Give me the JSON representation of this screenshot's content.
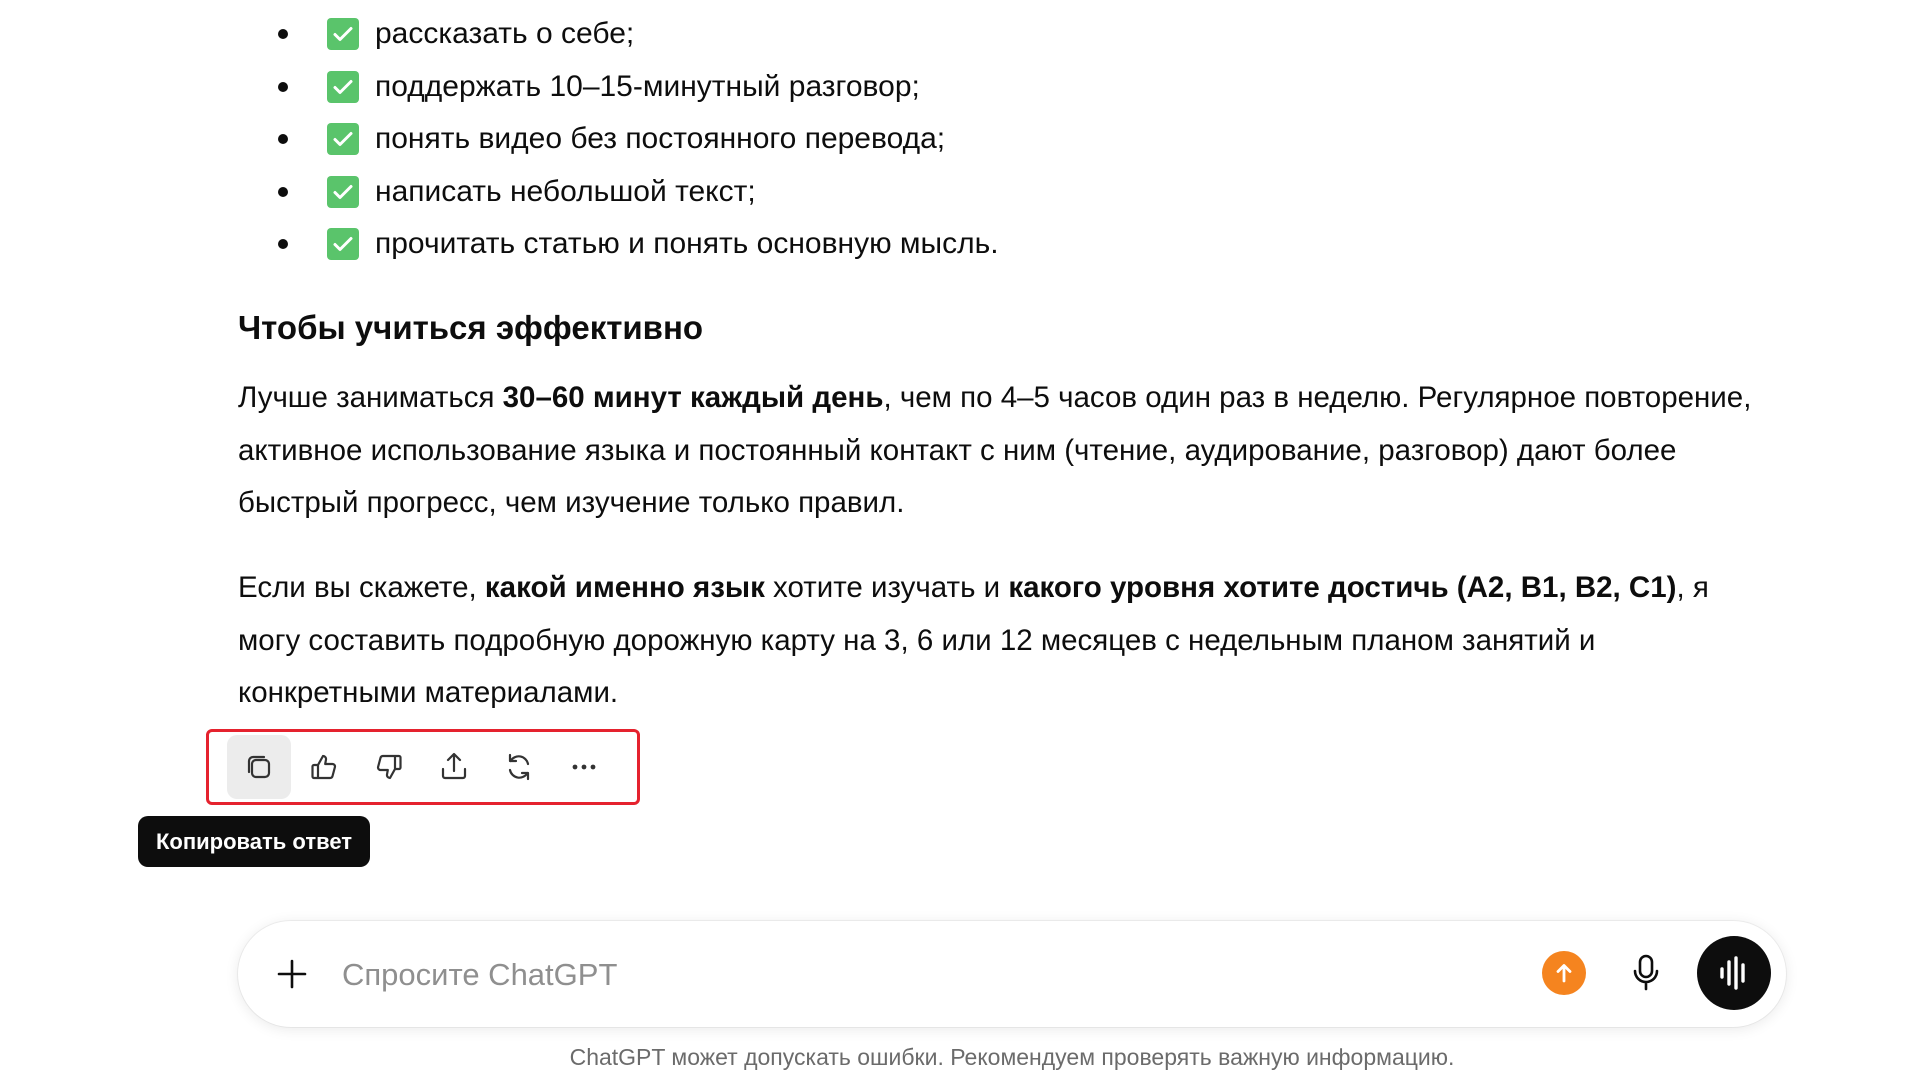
{
  "checklist": [
    "рассказать о себе;",
    "поддержать 10–15-минутный разговор;",
    "понять видео без постоянного перевода;",
    "написать небольшой текст;",
    "прочитать статью и понять основную мысль."
  ],
  "heading": "Чтобы учиться эффективно",
  "para1": {
    "t1": "Лучше заниматься ",
    "b1": "30–60 минут каждый день",
    "t2": ", чем по 4–5 часов один раз в неделю. Регулярное повторение, активное использование языка и постоянный контакт с ним (чтение, аудирование, разговор) дают более быстрый прогресс, чем изучение только правил."
  },
  "para2": {
    "t1": "Если вы скажете, ",
    "b1": "какой именно язык",
    "t2": " хотите изучать и ",
    "b2": "какого уровня хотите достичь (A2, B1, B2, C1)",
    "t3": ", я могу составить подробную дорожную карту на 3, 6 или 12 месяцев с недельным планом занятий и конкретными материалами."
  },
  "actions": {
    "icons": [
      "copy-icon",
      "thumbs-up-icon",
      "thumbs-down-icon",
      "share-icon",
      "regenerate-icon",
      "more-icon"
    ]
  },
  "tooltip": "Копировать ответ",
  "composer": {
    "placeholder": "Спросите ChatGPT",
    "value": ""
  },
  "colors": {
    "check": "#5ac46b",
    "upgrade": "#f5841f",
    "highlight_border": "#e5222e",
    "voice": "#0d0d0d"
  },
  "disclaimer": "ChatGPT может допускать ошибки. Рекомендуем проверять важную информацию."
}
